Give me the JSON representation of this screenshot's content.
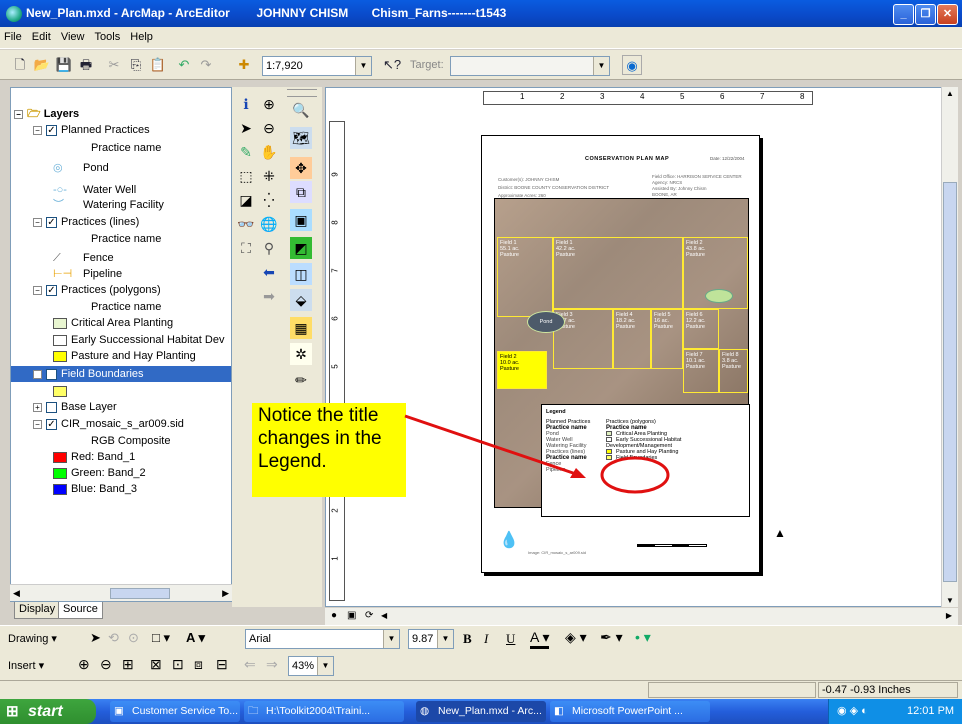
{
  "window": {
    "title": "New_Plan.mxd - ArcMap - ArcEditor        JOHNNY CHISM       Chism_Farns-------t1543"
  },
  "menu": [
    "File",
    "Edit",
    "View",
    "Tools",
    "Help"
  ],
  "toolbar": {
    "scale_value": "1:7,920",
    "target_label": "Target:"
  },
  "toc": {
    "root_label": "Layers",
    "items": [
      {
        "label": "Planned Practices",
        "checked": true,
        "level": "group"
      },
      {
        "label": "Practice name",
        "level": "heading"
      },
      {
        "label": "Pond",
        "level": "symbol",
        "icon": "pond-icon"
      },
      {
        "label": "Water Well",
        "level": "symbol",
        "icon": "water-well-icon"
      },
      {
        "label": "Watering Facility",
        "level": "symbol",
        "icon": "watering-facility-icon"
      },
      {
        "label": "Practices (lines)",
        "checked": true,
        "level": "group"
      },
      {
        "label": "Practice name",
        "level": "heading"
      },
      {
        "label": "Fence",
        "level": "symbol",
        "icon": "fence-icon"
      },
      {
        "label": "Pipeline",
        "level": "symbol",
        "icon": "pipeline-icon"
      },
      {
        "label": "Practices (polygons)",
        "checked": true,
        "level": "group"
      },
      {
        "label": "Practice name",
        "level": "heading"
      },
      {
        "label": "Critical Area Planting",
        "level": "symbol",
        "color": "#e8f5d0"
      },
      {
        "label": "Early Successional Habitat Dev",
        "level": "symbol",
        "color": "#ffffff"
      },
      {
        "label": "Pasture and Hay Planting",
        "level": "symbol",
        "color": "#ffff00"
      },
      {
        "label": "Field Boundaries",
        "checked": true,
        "level": "group",
        "selected": true
      },
      {
        "label": "",
        "level": "symbol",
        "color": "#ffff66"
      },
      {
        "label": "Base Layer",
        "checked": false,
        "level": "group",
        "collapsed": true
      },
      {
        "label": "CIR_mosaic_s_ar009.sid",
        "checked": true,
        "level": "group"
      },
      {
        "label": "RGB Composite",
        "level": "heading"
      },
      {
        "label": "Red:   Band_1",
        "level": "symbol",
        "color": "#ff0000"
      },
      {
        "label": "Green: Band_2",
        "level": "symbol",
        "color": "#00ff00"
      },
      {
        "label": "Blue:  Band_3",
        "level": "symbol",
        "color": "#0000ff"
      }
    ]
  },
  "toc_tabs": [
    "Display",
    "Source"
  ],
  "map_page": {
    "title": "CONSERVATION PLAN MAP",
    "date": "Date: 12/22/2004",
    "info_left": [
      "Customer(s): JOHNNY CHISM",
      "District: BOONE COUNTY CONSERVATION DISTRICT",
      "Approximate Acres: 260"
    ],
    "info_right": [
      "Field Office: HARRISON SERVICE CENTER",
      "Agency: NRCS",
      "Assisted By: Johnny Chism",
      "BOONE, AR"
    ],
    "fields": [
      {
        "name": "Field 1",
        "acres": "55.1 ac.",
        "use": "Pasture"
      },
      {
        "name": "Field 1",
        "acres": "42.2 ac.",
        "use": "Pasture"
      },
      {
        "name": "Field 2",
        "acres": "43.8 ac.",
        "use": "Pasture"
      },
      {
        "name": "Field 3",
        "acres": "22.7 ac.",
        "use": "Pasture"
      },
      {
        "name": "Field 4",
        "acres": "18.2 ac.",
        "use": "Pasture"
      },
      {
        "name": "Field 5",
        "acres": "16 ac.",
        "use": "Pasture"
      },
      {
        "name": "Field 6",
        "acres": "12.2 ac.",
        "use": "Pasture"
      },
      {
        "name": "Field 7",
        "acres": "10.1 ac.",
        "use": "Pasture"
      },
      {
        "name": "Field 8",
        "acres": "3.8 ac.",
        "use": "Pasture"
      },
      {
        "name": "Field 2",
        "acres": "10.0 ac.",
        "use": "Pasture"
      }
    ],
    "pond_label": "Pond",
    "image_credit": "Image: CIR_mosaic_s_ar009.sid",
    "legend": {
      "title": "Legend",
      "col1_header": "Planned Practices",
      "col2_header": "Practices (polygons)",
      "practice_name": "Practice name",
      "col1_items": [
        "Pond",
        "Water Well",
        "Watering Facility",
        "Practices (lines)",
        "Practice name",
        "Fence",
        "Pipeline"
      ],
      "col2_items": [
        "Critical Area Planting",
        "Early Successional Habitat Development/Management",
        "Pasture and Hay Planting",
        "Field Boundaries"
      ]
    }
  },
  "annotation": {
    "note": "Notice the title changes in the Legend."
  },
  "draw_toolbar": {
    "drawing_label": "Drawing",
    "font_name": "Arial",
    "font_size": "9.87",
    "bold": "B",
    "italic": "I",
    "underline": "U"
  },
  "insert_toolbar": {
    "insert_label": "Insert",
    "zoom_value": "43%"
  },
  "status": {
    "coords": "-0.47  -0.93 Inches"
  },
  "taskbar": {
    "start_label": "start",
    "tasks": [
      "Customer Service To...",
      "H:\\Toolkit2004\\Traini...",
      "New_Plan.mxd - Arc...",
      "Microsoft PowerPoint ..."
    ],
    "clock": "12:01 PM"
  }
}
